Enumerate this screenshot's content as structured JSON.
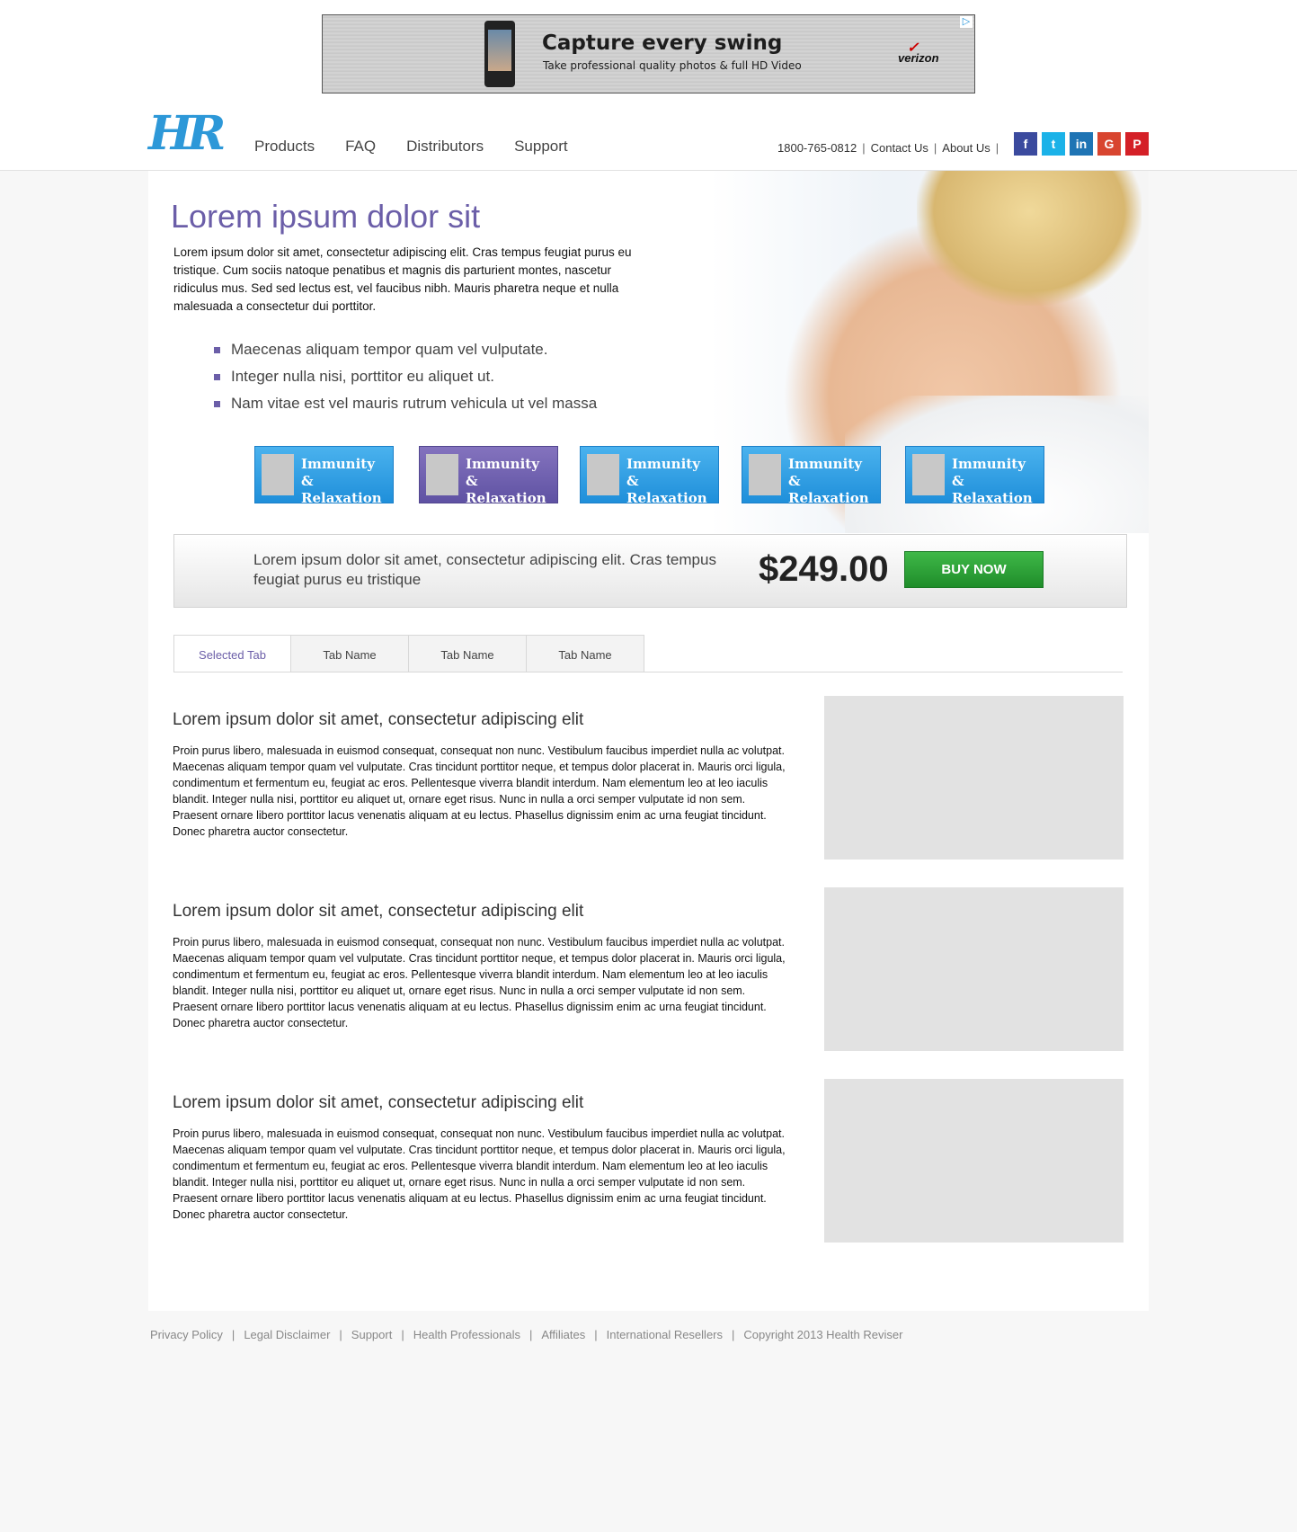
{
  "ad": {
    "headline": "Capture every swing",
    "subline": "Take professional quality photos & full HD Video",
    "brand": "verizon"
  },
  "header": {
    "logo": "HR",
    "nav": [
      "Products",
      "FAQ",
      "Distributors",
      "Support"
    ],
    "phone": "1800-765-0812",
    "contact": "Contact Us",
    "about": "About Us",
    "social": [
      {
        "icon": "facebook-icon",
        "glyph": "f",
        "color": "#3b4a9e"
      },
      {
        "icon": "twitter-icon",
        "glyph": "t",
        "color": "#1bb2e8"
      },
      {
        "icon": "linkedin-icon",
        "glyph": "in",
        "color": "#1f74b4"
      },
      {
        "icon": "googleplus-icon",
        "glyph": "G",
        "color": "#d8452f"
      },
      {
        "icon": "pinterest-icon",
        "glyph": "P",
        "color": "#d42027"
      }
    ]
  },
  "hero": {
    "title": "Lorem ipsum dolor sit",
    "description": "Lorem ipsum dolor sit amet, consectetur adipiscing elit. Cras tempus feugiat purus eu tristique. Cum sociis natoque penatibus et magnis dis parturient montes, nascetur ridiculus mus. Sed sed lectus est, vel faucibus nibh. Mauris pharetra neque et nulla malesuada a consectetur dui porttitor.",
    "bullets": [
      "Maecenas aliquam tempor quam vel vulputate.",
      "Integer nulla nisi, porttitor eu aliquet ut.",
      "Nam vitae est vel mauris rutrum vehicula ut vel massa"
    ]
  },
  "categories": [
    "Immunity & Relaxation",
    "Immunity & Relaxation",
    "Immunity & Relaxation",
    "Immunity & Relaxation",
    "Immunity & Relaxation"
  ],
  "price_bar": {
    "text": "Lorem ipsum dolor sit amet, consectetur adipiscing elit. Cras tempus feugiat purus eu tristique",
    "price": "$249.00",
    "buy_label": "BUY NOW"
  },
  "tabs": [
    "Selected Tab",
    "Tab Name",
    "Tab Name",
    "Tab Name"
  ],
  "articles": [
    {
      "title": "Lorem ipsum dolor sit amet, consectetur adipiscing elit",
      "body": "Proin purus libero, malesuada in euismod consequat, consequat non nunc. Vestibulum faucibus imperdiet nulla ac volutpat. Maecenas aliquam tempor quam vel vulputate. Cras tincidunt porttitor neque, et tempus dolor placerat in. Mauris orci ligula, condimentum et fermentum eu, feugiat ac eros. Pellentesque viverra blandit interdum. Nam elementum leo at leo iaculis blandit. Integer nulla nisi, porttitor eu aliquet ut, ornare eget risus. Nunc in nulla a orci semper vulputate id non sem. Praesent ornare libero porttitor lacus venenatis aliquam at eu lectus. Phasellus dignissim enim ac urna feugiat tincidunt. Donec pharetra auctor consectetur."
    },
    {
      "title": "Lorem ipsum dolor sit amet, consectetur adipiscing elit",
      "body": "Proin purus libero, malesuada in euismod consequat, consequat non nunc. Vestibulum faucibus imperdiet nulla ac volutpat. Maecenas aliquam tempor quam vel vulputate. Cras tincidunt porttitor neque, et tempus dolor placerat in. Mauris orci ligula, condimentum et fermentum eu, feugiat ac eros. Pellentesque viverra blandit interdum. Nam elementum leo at leo iaculis blandit. Integer nulla nisi, porttitor eu aliquet ut, ornare eget risus. Nunc in nulla a orci semper vulputate id non sem. Praesent ornare libero porttitor lacus venenatis aliquam at eu lectus. Phasellus dignissim enim ac urna feugiat tincidunt. Donec pharetra auctor consectetur."
    },
    {
      "title": "Lorem ipsum dolor sit amet, consectetur adipiscing elit",
      "body": "Proin purus libero, malesuada in euismod consequat, consequat non nunc. Vestibulum faucibus imperdiet nulla ac volutpat. Maecenas aliquam tempor quam vel vulputate. Cras tincidunt porttitor neque, et tempus dolor placerat in. Mauris orci ligula, condimentum et fermentum eu, feugiat ac eros. Pellentesque viverra blandit interdum. Nam elementum leo at leo iaculis blandit. Integer nulla nisi, porttitor eu aliquet ut, ornare eget risus. Nunc in nulla a orci semper vulputate id non sem. Praesent ornare libero porttitor lacus venenatis aliquam at eu lectus. Phasellus dignissim enim ac urna feugiat tincidunt. Donec pharetra auctor consectetur."
    }
  ],
  "footer": {
    "links": [
      "Privacy Policy",
      "Legal Disclaimer",
      "Support",
      "Health Professionals",
      "Affiliates",
      "International Resellers"
    ],
    "copyright": "Copyright 2013 Health Reviser"
  }
}
